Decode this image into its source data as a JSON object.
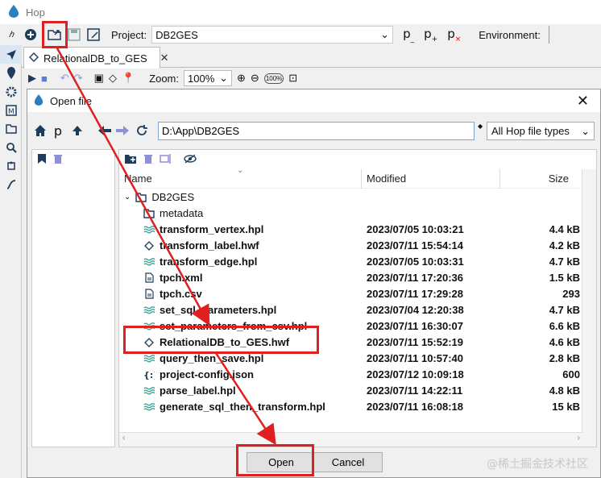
{
  "app": {
    "title": "Hop"
  },
  "toolbar": {
    "project_label": "Project:",
    "project_value": "DB2GES",
    "environment_label": "Environment:",
    "icons": [
      "logo-icon",
      "hop-icon",
      "add-icon",
      "open-file-icon",
      "save-icon",
      "save-as-icon"
    ]
  },
  "tab": {
    "label": "RelationalDB_to_GES",
    "close": "✕"
  },
  "subtoolbar": {
    "zoom_label": "Zoom:",
    "zoom_value": "100%",
    "zoom_100": "100%"
  },
  "dialog": {
    "title": "Open file",
    "path": "D:\\App\\DB2GES",
    "filter": "All Hop file types",
    "columns": {
      "name": "Name",
      "modified": "Modified",
      "size": "Size"
    },
    "root_folder": "DB2GES",
    "rows": [
      {
        "name": "metadata",
        "modified": "",
        "size": "",
        "icon": "folder-icon"
      },
      {
        "name": "transform_vertex.hpl",
        "modified": "2023/07/05 10:03:21",
        "size": "4.4 kB",
        "icon": "pipeline-icon"
      },
      {
        "name": "transform_label.hwf",
        "modified": "2023/07/11 15:54:14",
        "size": "4.2 kB",
        "icon": "workflow-icon"
      },
      {
        "name": "transform_edge.hpl",
        "modified": "2023/07/05 10:03:31",
        "size": "4.7 kB",
        "icon": "pipeline-icon"
      },
      {
        "name": "tpch.xml",
        "modified": "2023/07/11 17:20:36",
        "size": "1.5 kB",
        "icon": "file-icon"
      },
      {
        "name": "tpch.csv",
        "modified": "2023/07/11 17:29:28",
        "size": "293",
        "icon": "file-icon"
      },
      {
        "name": "set_sql_parameters.hpl",
        "modified": "2023/07/04 12:20:38",
        "size": "4.7 kB",
        "icon": "pipeline-icon"
      },
      {
        "name": "set_parameters_from_csv.hpl",
        "modified": "2023/07/11 16:30:07",
        "size": "6.6 kB",
        "icon": "pipeline-icon"
      },
      {
        "name": "RelationalDB_to_GES.hwf",
        "modified": "2023/07/11 15:52:19",
        "size": "4.6 kB",
        "icon": "workflow-icon"
      },
      {
        "name": "query_then_save.hpl",
        "modified": "2023/07/11 10:57:40",
        "size": "2.8 kB",
        "icon": "pipeline-icon"
      },
      {
        "name": "project-config.json",
        "modified": "2023/07/12 10:09:18",
        "size": "600",
        "icon": "json-icon"
      },
      {
        "name": "parse_label.hpl",
        "modified": "2023/07/11 14:22:11",
        "size": "4.8 kB",
        "icon": "pipeline-icon"
      },
      {
        "name": "generate_sql_then_transform.hpl",
        "modified": "2023/07/11 16:08:18",
        "size": "15 kB",
        "icon": "pipeline-icon"
      }
    ],
    "open_button": "Open",
    "cancel_button": "Cancel"
  },
  "watermark": "@稀土掘金技术社区",
  "colors": {
    "annotation": "#e02020",
    "accent": "#1f6fbf",
    "pipeline": "#2a9d8f"
  }
}
